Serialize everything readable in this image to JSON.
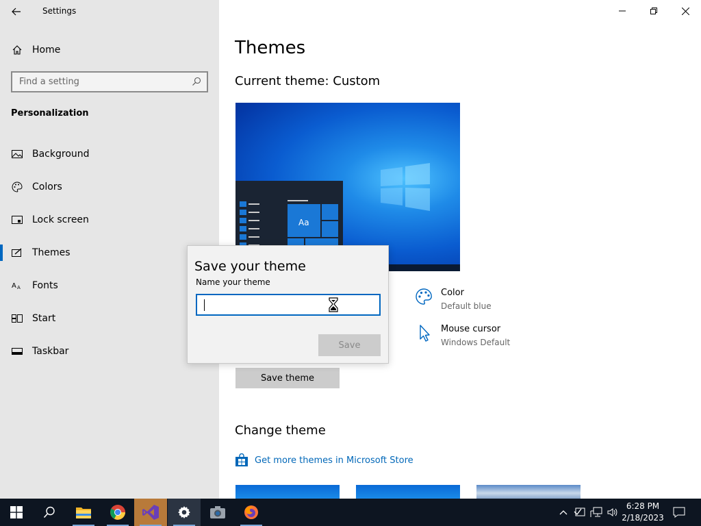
{
  "window": {
    "app_title": "Settings"
  },
  "sidebar": {
    "home_label": "Home",
    "search_placeholder": "Find a setting",
    "section_header": "Personalization",
    "items": [
      {
        "label": "Background",
        "icon": "image-icon"
      },
      {
        "label": "Colors",
        "icon": "palette-icon"
      },
      {
        "label": "Lock screen",
        "icon": "lock-screen-icon"
      },
      {
        "label": "Themes",
        "icon": "themes-icon",
        "active": true
      },
      {
        "label": "Fonts",
        "icon": "fonts-icon"
      },
      {
        "label": "Start",
        "icon": "start-icon"
      },
      {
        "label": "Taskbar",
        "icon": "taskbar-icon"
      }
    ]
  },
  "main": {
    "title": "Themes",
    "current_theme": "Current theme: Custom",
    "preview_tile_text": "Aa",
    "attributes": [
      {
        "label": "Color",
        "value": "Default blue",
        "icon": "palette-icon"
      },
      {
        "label": "Mouse cursor",
        "value": "Windows Default",
        "icon": "cursor-icon"
      }
    ],
    "save_theme_label": "Save theme",
    "change_theme_heading": "Change theme",
    "store_link": "Get more themes in Microsoft Store"
  },
  "dialog": {
    "title": "Save your theme",
    "subtitle": "Name your theme",
    "input_value": "",
    "save_label": "Save"
  },
  "taskbar": {
    "time": "6:28 PM",
    "date": "2/18/2023",
    "apps": [
      "start-button",
      "search-button",
      "file-explorer",
      "chrome",
      "visual-studio",
      "settings",
      "camera",
      "firefox"
    ]
  },
  "colors": {
    "accent": "#0067c0",
    "sidebar_bg": "#e6e6e6",
    "taskbar_bg": "#0d1521",
    "link": "#0067b8"
  }
}
